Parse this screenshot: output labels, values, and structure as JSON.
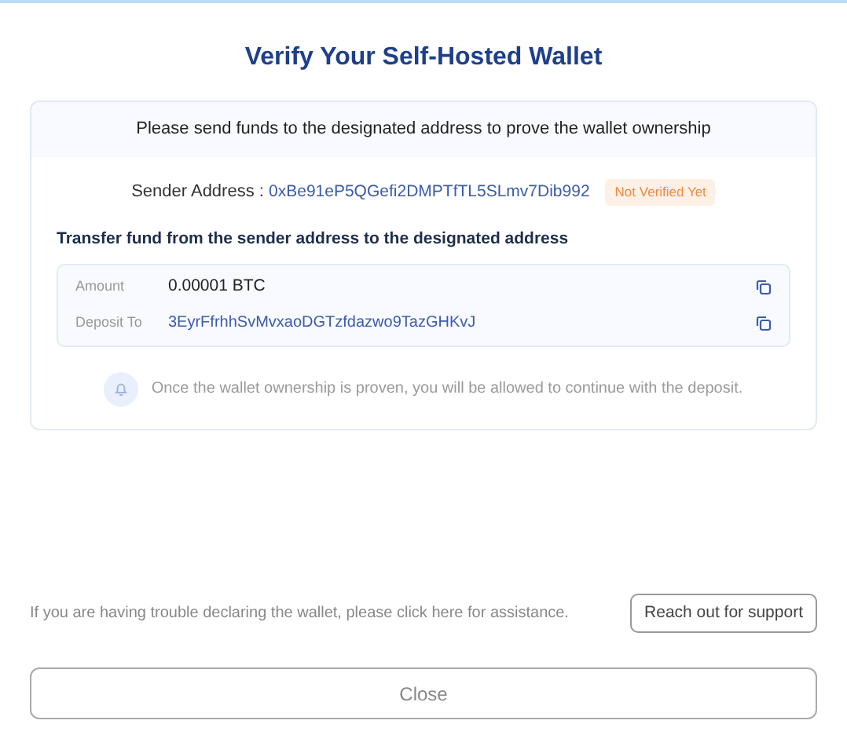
{
  "title": "Verify Your Self-Hosted Wallet",
  "card": {
    "header": "Please send funds to the designated address to prove the wallet ownership",
    "sender": {
      "label": "Sender Address :",
      "address": "0xBe91eP5QGefi2DMPTfTL5SLmv7Dib992",
      "badge": "Not Verified Yet"
    },
    "transfer_heading": "Transfer fund from the sender address to the designated address",
    "details": [
      {
        "label": "Amount",
        "value": "0.00001 BTC",
        "kind": "plain"
      },
      {
        "label": "Deposit To",
        "value": "3EyrFfrhhSvMvxaoDGTzfdazwo9TazGHKvJ",
        "kind": "link"
      }
    ],
    "note": "Once the wallet ownership is proven, you will be allowed to continue with the deposit."
  },
  "help": {
    "text": "If you are having trouble declaring the wallet, please click here for assistance.",
    "button": "Reach out for support"
  },
  "close_button": "Close"
}
